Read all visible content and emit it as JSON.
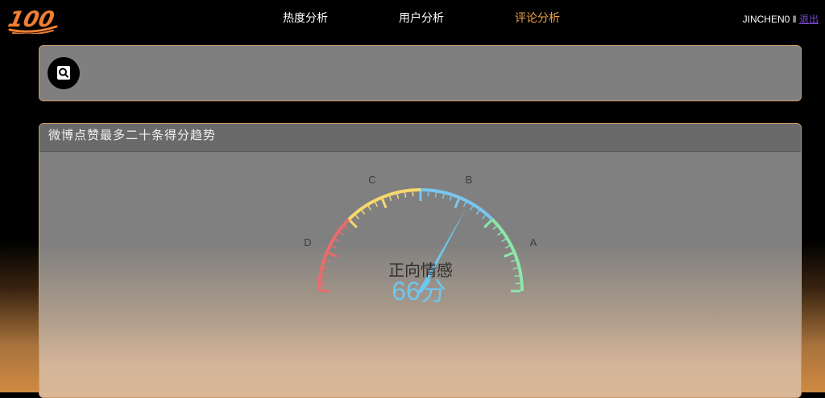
{
  "header": {
    "logo_text": "100",
    "nav": [
      {
        "label": "热度分析",
        "active": false
      },
      {
        "label": "用户分析",
        "active": false
      },
      {
        "label": "评论分析",
        "active": true
      }
    ],
    "user": {
      "name": "JINCHEN0",
      "separator": "‖",
      "logout_label": "退出"
    }
  },
  "search": {
    "icon": "search-icon"
  },
  "panel": {
    "title": "微博点赞最多二十条得分趋势",
    "gauge": {
      "grades": [
        "D",
        "C",
        "B",
        "A"
      ],
      "label": "正向情感",
      "score_text": "66分",
      "value": 66,
      "min": 0,
      "max": 100,
      "band_colors": [
        "#e96c6c",
        "#f5d86e",
        "#79c6ef",
        "#8de7a8"
      ]
    }
  },
  "colors": {
    "accent": "#f0a24a",
    "card_border": "#c79a66",
    "score": "#6ec7f0"
  }
}
